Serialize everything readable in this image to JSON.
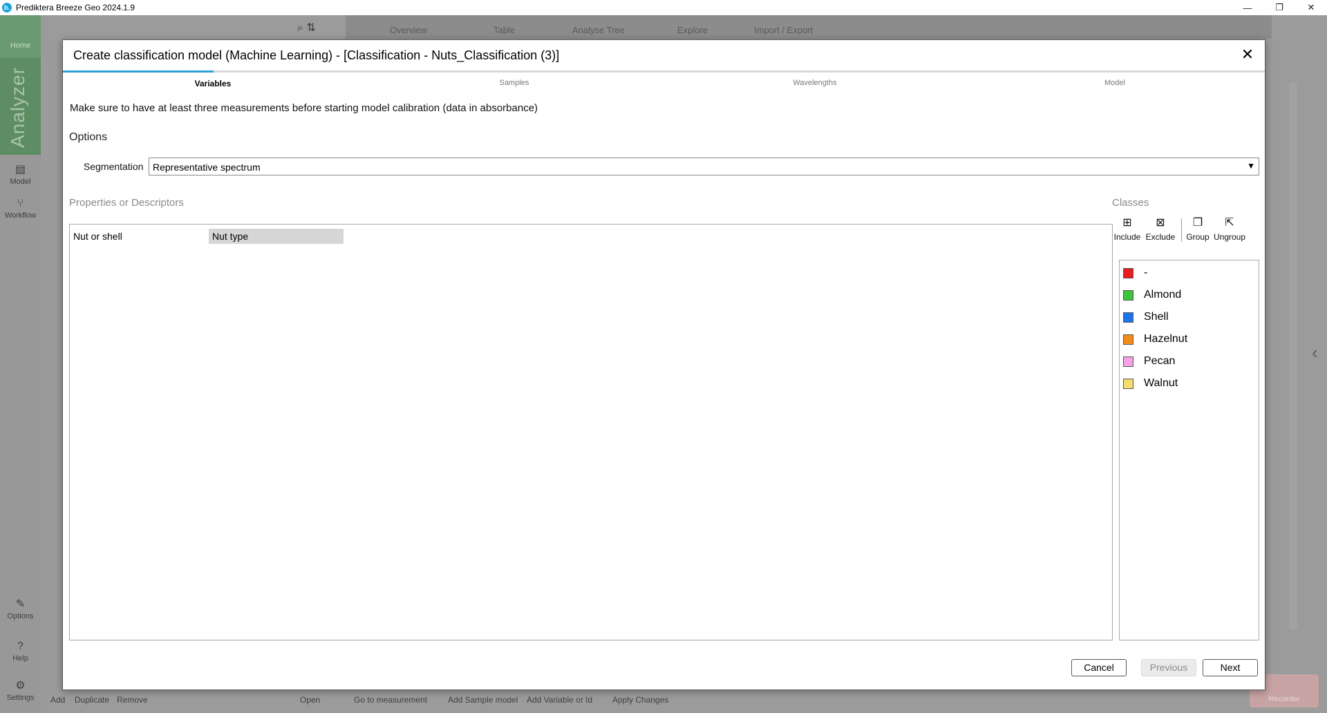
{
  "app": {
    "logo_letter": "b.",
    "title": "Prediktera Breeze Geo 2024.1.9",
    "window_controls": [
      "—",
      "❐",
      "✕"
    ]
  },
  "background": {
    "nav": {
      "home": "Home",
      "analyzer": "Analyzer",
      "model": "Model",
      "workflow": "Workflow",
      "options": "Options",
      "help": "Help",
      "settings": "Settings"
    },
    "tabs": [
      "Overview",
      "Table",
      "Analyse Tree",
      "Explore",
      "Import / Export"
    ],
    "bottom": [
      "Add",
      "Duplicate",
      "Remove",
      "Open",
      "Go to measurement",
      "Add Sample model",
      "Add Variable or Id",
      "Apply Changes"
    ],
    "recorder": "Recorder"
  },
  "dialog": {
    "title": "Create classification model (Machine Learning) - [Classification - Nuts_Classification (3)]",
    "close": "✕",
    "steps": [
      "Variables",
      "Samples",
      "Wavelengths",
      "Model"
    ],
    "hint": "Make sure to have at least three measurements before starting model calibration (data in absorbance)",
    "options_heading": "Options",
    "segmentation_label": "Segmentation",
    "segmentation_value": "Representative spectrum",
    "properties_heading": "Properties or Descriptors",
    "properties": [
      {
        "name": "Nut or shell",
        "value": "Nut type"
      }
    ],
    "classes_heading": "Classes",
    "class_tools": [
      "Include",
      "Exclude",
      "Group",
      "Ungroup"
    ],
    "classes": [
      {
        "name": "-",
        "color": "#e81d1d"
      },
      {
        "name": "Almond",
        "color": "#3ec43e"
      },
      {
        "name": "Shell",
        "color": "#1a73e8"
      },
      {
        "name": "Hazelnut",
        "color": "#f28a1c"
      },
      {
        "name": "Pecan",
        "color": "#f5a3e6"
      },
      {
        "name": "Walnut",
        "color": "#f7dc6f"
      }
    ],
    "buttons": {
      "cancel": "Cancel",
      "previous": "Previous",
      "next": "Next"
    }
  }
}
